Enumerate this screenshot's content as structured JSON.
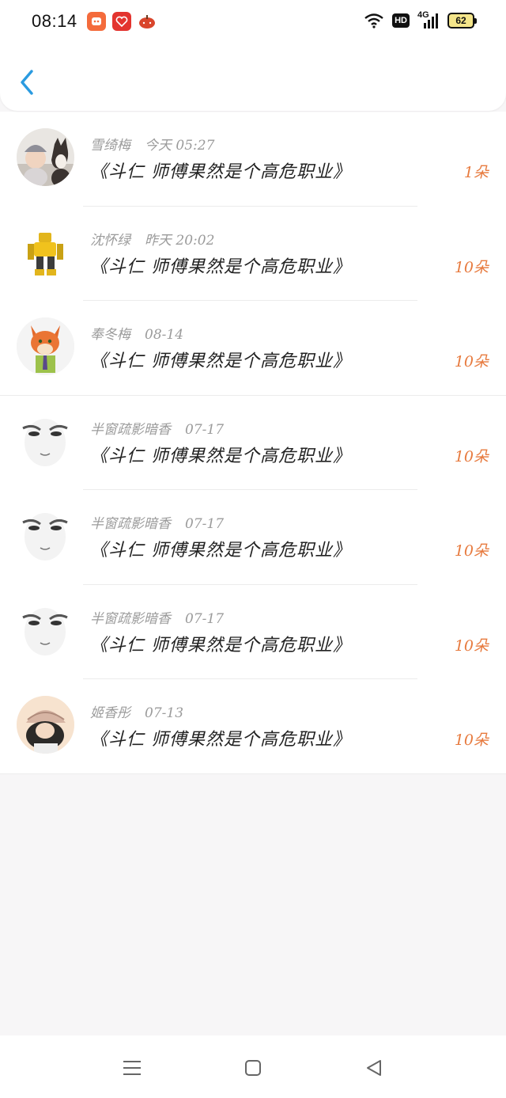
{
  "status_bar": {
    "time": "08:14",
    "network": "4G",
    "hd": "HD",
    "battery": "62",
    "icons": [
      "app-icon-orange",
      "app-icon-red",
      "app-icon-pumpkin",
      "wifi-icon",
      "signal-icon"
    ]
  },
  "header": {
    "back_icon": "chevron-left-icon"
  },
  "colors": {
    "accent_blue": "#2b9be0",
    "amount_orange": "#e77a3e",
    "secondary_text": "#9b9b9b"
  },
  "items": [
    {
      "name": "雪绮梅",
      "date": "今天 05:27",
      "message": "《斗仁 师傅果然是个高危职业》",
      "amount": "1朵",
      "avatar": "child-and-dog-photo"
    },
    {
      "name": "沈怀绿",
      "date": "昨天 20:02",
      "message": "《斗仁 师傅果然是个高危职业》",
      "amount": "10朵",
      "avatar": "yellow-robot"
    },
    {
      "name": "奉冬梅",
      "date": "08-14",
      "message": "《斗仁 师傅果然是个高危职业》",
      "amount": "10朵",
      "avatar": "cartoon-fox"
    },
    {
      "name": "半窗疏影暗香",
      "date": "07-17",
      "message": "《斗仁 师傅果然是个高危职业》",
      "amount": "10朵",
      "avatar": "sketch-face"
    },
    {
      "name": "半窗疏影暗香",
      "date": "07-17",
      "message": "《斗仁 师傅果然是个高危职业》",
      "amount": "10朵",
      "avatar": "sketch-face"
    },
    {
      "name": "半窗疏影暗香",
      "date": "07-17",
      "message": "《斗仁 师傅果然是个高危职业》",
      "amount": "10朵",
      "avatar": "sketch-face"
    },
    {
      "name": "姬香彤",
      "date": "07-13",
      "message": "《斗仁 师傅果然是个高危职业》",
      "amount": "10朵",
      "avatar": "girl-with-cap"
    }
  ],
  "nav": {
    "icons": [
      "menu-icon",
      "home-square-icon",
      "back-triangle-icon"
    ]
  }
}
